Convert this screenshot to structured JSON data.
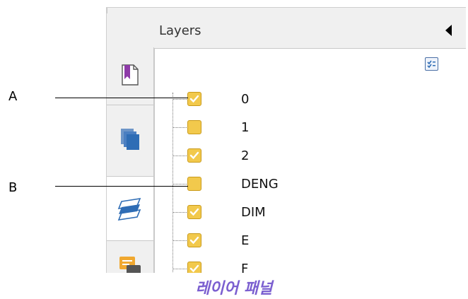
{
  "panel": {
    "title": "Layers",
    "layers": [
      {
        "name": "0",
        "checked": true
      },
      {
        "name": "1",
        "checked": false
      },
      {
        "name": "2",
        "checked": true
      },
      {
        "name": "DENG",
        "checked": false
      },
      {
        "name": "DIM",
        "checked": true
      },
      {
        "name": "E",
        "checked": true
      },
      {
        "name": "F",
        "checked": true
      }
    ]
  },
  "tabs": [
    {
      "icon": "bookmark-icon"
    },
    {
      "icon": "pages-icon"
    },
    {
      "icon": "layers-icon",
      "active": true
    },
    {
      "icon": "comments-icon"
    }
  ],
  "callouts": {
    "a": "A",
    "b": "B"
  },
  "caption": "레이어 패널",
  "colors": {
    "checkbox": "#f2c94c",
    "caption": "#7b5fd0",
    "accent": "#2f6db5"
  }
}
